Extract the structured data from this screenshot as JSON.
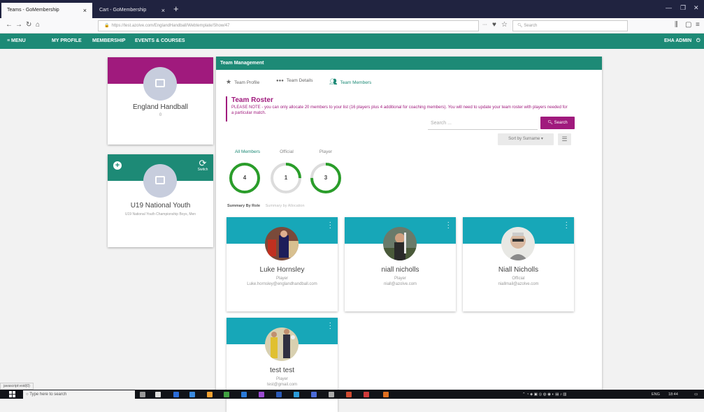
{
  "browser": {
    "tabs": [
      {
        "title": "Teams - GoMembership",
        "close": "×"
      },
      {
        "title": "Cart - GoMembership",
        "close": "×"
      }
    ],
    "new_tab": "+",
    "url": "https://test.azolve.com/EnglandHandball/Webtemplate/Show/47",
    "search_placeholder": "Search",
    "status_url": "javascript:void(0)"
  },
  "appnav": {
    "menu": "≡ MENU",
    "items": [
      "MY PROFILE",
      "MEMBERSHIP",
      "EVENTS & COURSES"
    ],
    "user": "EHA ADMIN"
  },
  "org_card": {
    "name": "England Handball",
    "sub": "0"
  },
  "team_card": {
    "switch_label": "Switch",
    "name": "U19 National Youth",
    "sub": "U19 National Youth Championship Boys, Men"
  },
  "panel": {
    "title": "Team Management",
    "tabs": [
      "Team Profile",
      "Team Details",
      "Team Members"
    ],
    "roster_title": "Team Roster",
    "roster_note": "PLEASE NOTE - you can only allocate 20 members to your list (16 players plus 4 additional for coaching members). You will need to update your team roster with players needed for a particular match.",
    "search_placeholder": "Search ...",
    "search_button": "Search",
    "sort_label": "Sort by Surname ▾",
    "summary_by_role": "Summary By Role",
    "summary_by_allocation": "Summary by Allocation"
  },
  "stats": [
    {
      "label": "All Members",
      "value": "4",
      "fraction": 1.0
    },
    {
      "label": "Official",
      "value": "1",
      "fraction": 0.25
    },
    {
      "label": "Player",
      "value": "3",
      "fraction": 0.75
    }
  ],
  "members": [
    {
      "name": "Luke Hornsley",
      "role": "Player",
      "email": "Luke.hornsley@englandhandball.com"
    },
    {
      "name": "niall nicholls",
      "role": "Player",
      "email": "niall@azolve.com"
    },
    {
      "name": "Niall Nicholls",
      "role": "Official",
      "email": "niallmail@azolve.com"
    },
    {
      "name": "test test",
      "role": "Player",
      "email": "test@gmail.com"
    }
  ],
  "taskbar": {
    "search_placeholder": "Type here to search",
    "time": "18:44",
    "lang": "ENG"
  },
  "colors": {
    "teal": "#1d8a76",
    "magenta": "#a01a7d",
    "cyan": "#17a7b8",
    "ring": "#2a9d2a"
  }
}
